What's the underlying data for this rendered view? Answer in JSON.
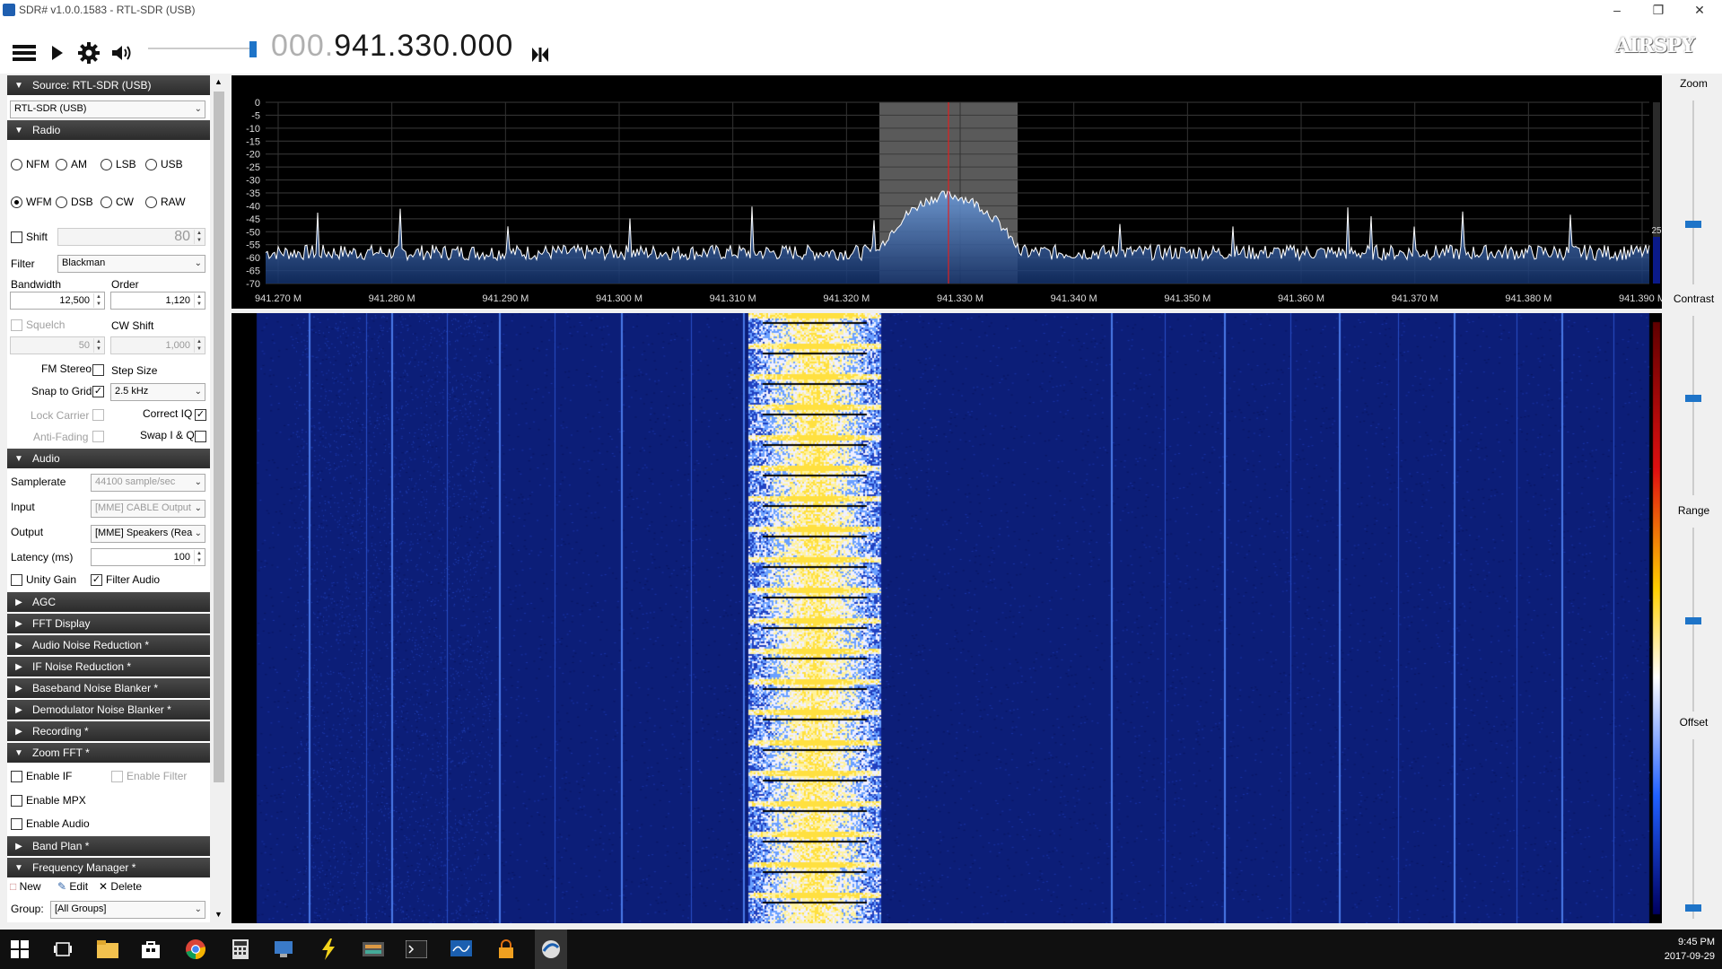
{
  "window": {
    "title": "SDR# v1.0.0.1583 - RTL-SDR (USB)"
  },
  "toolbar": {
    "frequency_prefix": "000.",
    "frequency_main": "941.330.000",
    "logo": "AIRSPY"
  },
  "source": {
    "header": "Source: RTL-SDR (USB)",
    "device": "RTL-SDR (USB)"
  },
  "radio": {
    "header": "Radio",
    "modes_row1": [
      "NFM",
      "AM",
      "LSB",
      "USB"
    ],
    "modes_row2": [
      "WFM",
      "DSB",
      "CW",
      "RAW"
    ],
    "selected_mode": "WFM",
    "shift_label": "Shift",
    "shift_value": "80",
    "filter_label": "Filter",
    "filter_value": "Blackman",
    "bandwidth_label": "Bandwidth",
    "bandwidth_value": "12,500",
    "order_label": "Order",
    "order_value": "1,120",
    "squelch_label": "Squelch",
    "squelch_value": "50",
    "cw_shift_label": "CW Shift",
    "cw_shift_value": "1,000",
    "fm_stereo_label": "FM Stereo",
    "step_size_label": "Step Size",
    "snap_label": "Snap to Grid",
    "step_value": "2.5 kHz",
    "lock_carrier_label": "Lock Carrier",
    "correct_iq_label": "Correct IQ",
    "anti_fading_label": "Anti-Fading",
    "swap_iq_label": "Swap I & Q"
  },
  "audio": {
    "header": "Audio",
    "samplerate_label": "Samplerate",
    "samplerate_value": "44100 sample/sec",
    "input_label": "Input",
    "input_value": "[MME] CABLE Output",
    "output_label": "Output",
    "output_value": "[MME] Speakers (Rea",
    "latency_label": "Latency (ms)",
    "latency_value": "100",
    "unity_gain_label": "Unity Gain",
    "filter_audio_label": "Filter Audio"
  },
  "collapsed_sections": [
    "AGC",
    "FFT Display",
    "Audio Noise Reduction *",
    "IF Noise Reduction *",
    "Baseband Noise Blanker *",
    "Demodulator Noise Blanker *",
    "Recording *"
  ],
  "zoom_fft": {
    "header": "Zoom FFT *",
    "enable_if": "Enable IF",
    "enable_filter": "Enable Filter",
    "enable_mpx": "Enable MPX",
    "enable_audio": "Enable Audio"
  },
  "band_plan": {
    "header": "Band Plan *"
  },
  "freq_manager": {
    "header": "Frequency Manager *",
    "new_label": "New",
    "edit_label": "Edit",
    "delete_label": "Delete",
    "group_label": "Group:",
    "group_value": "[All Groups]"
  },
  "spectrum": {
    "db_labels": [
      "0",
      "-5",
      "-10",
      "-15",
      "-20",
      "-25",
      "-30",
      "-35",
      "-40",
      "-45",
      "-50",
      "-55",
      "-60",
      "-65",
      "-70"
    ],
    "freq_labels": [
      "941.270 M",
      "941.280 M",
      "941.290 M",
      "941.300 M",
      "941.310 M",
      "941.320 M",
      "941.330 M",
      "941.340 M",
      "941.350 M",
      "941.360 M",
      "941.370 M",
      "941.380 M",
      "941.390 M"
    ],
    "scale_value": "25"
  },
  "right": {
    "zoom": "Zoom",
    "contrast": "Contrast",
    "range": "Range",
    "offset": "Offset"
  },
  "clock": {
    "time": "9:45 PM",
    "date": "2017-09-29"
  }
}
